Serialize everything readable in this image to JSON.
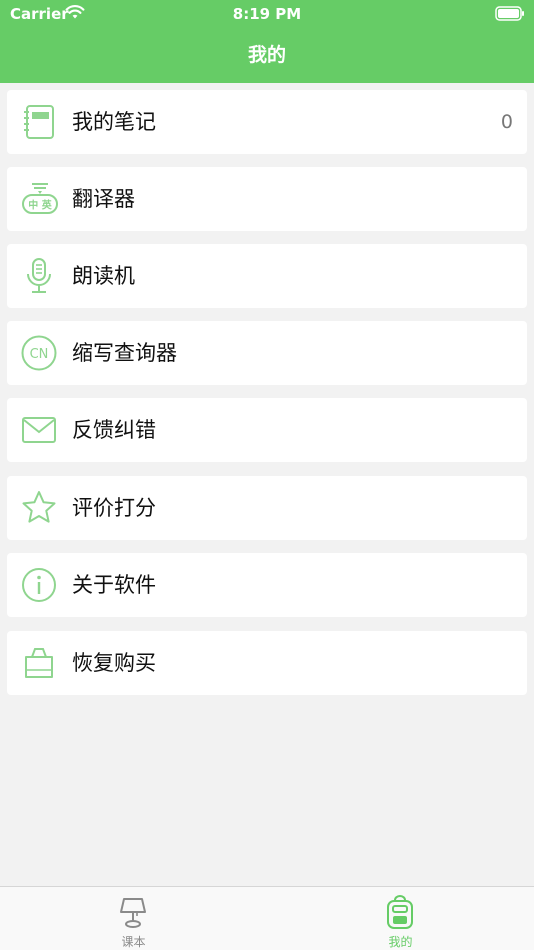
{
  "status_bar": {
    "carrier": "Carrier",
    "time": "8:19 PM"
  },
  "header": {
    "title": "我的",
    "background": "#66cc66"
  },
  "menu": {
    "items": [
      {
        "label": "我的笔记",
        "icon": "notebook-icon",
        "count": "0"
      },
      {
        "label": "翻译器",
        "icon": "translator-icon",
        "icon_text": "中 英"
      },
      {
        "label": "朗读机",
        "icon": "microphone-icon"
      },
      {
        "label": "缩写查询器",
        "icon": "cn-abbreviation-icon",
        "icon_text": "CN"
      },
      {
        "label": "反馈纠错",
        "icon": "mail-icon"
      },
      {
        "label": "评价打分",
        "icon": "star-icon"
      },
      {
        "label": "关于软件",
        "icon": "info-icon"
      },
      {
        "label": "恢复购买",
        "icon": "shopping-bag-icon"
      }
    ]
  },
  "tabbar": {
    "tabs": [
      {
        "label": "课本",
        "icon": "lamp-icon",
        "active": false
      },
      {
        "label": "我的",
        "icon": "backpack-icon",
        "active": true
      }
    ],
    "active_color": "#66cc66",
    "inactive_color": "#8a8a8a"
  },
  "colors": {
    "icon_green": "#8fd58f",
    "background": "#f2f2f2"
  }
}
